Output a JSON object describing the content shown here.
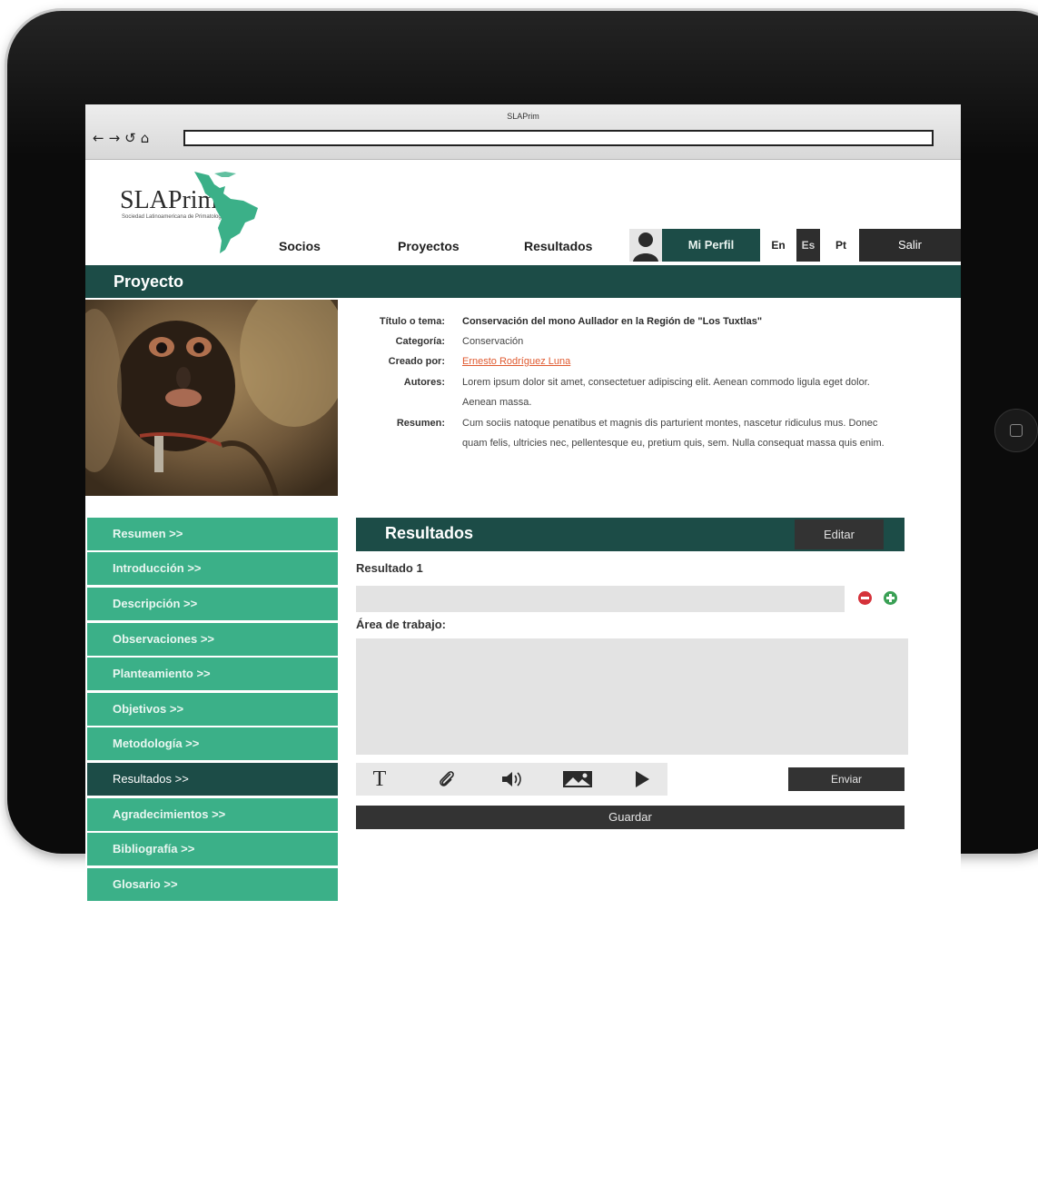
{
  "browser": {
    "window_title": "SLAPrim",
    "nav_icons": [
      "back-icon",
      "forward-icon",
      "reload-icon",
      "home-icon"
    ],
    "address_value": ""
  },
  "header": {
    "logo_title": "SLAPrim",
    "logo_subtitle": "Sociedad Latinoamericana de Primatología",
    "nav": [
      "Socios",
      "Proyectos",
      "Resultados"
    ],
    "profile_label": "Mi Perfil",
    "languages": [
      "En",
      "Es",
      "Pt"
    ],
    "selected_language": "Es",
    "logout_label": "Salir"
  },
  "section_title": "Proyecto",
  "project": {
    "labels": {
      "title": "Título o tema:",
      "category": "Categoría:",
      "created_by": "Creado por:",
      "authors": "Autores:",
      "summary": "Resumen:"
    },
    "title": "Conservación del mono Aullador en la Región de \"Los Tuxtlas\"",
    "category": "Conservación",
    "created_by": "Ernesto Rodríguez Luna",
    "authors": "Lorem ipsum dolor sit amet, consectetuer adipiscing elit. Aenean commodo ligula eget dolor. Aenean massa.",
    "summary": "Cum sociis natoque penatibus et magnis dis parturient montes, nascetur ridiculus mus. Donec quam felis, ultricies nec, pellentesque eu, pretium quis, sem. Nulla consequat massa quis enim."
  },
  "sidebar": {
    "items": [
      {
        "label": "Resumen >>"
      },
      {
        "label": "Introducción >>"
      },
      {
        "label": "Descripción >>"
      },
      {
        "label": "Observaciones >>"
      },
      {
        "label": "Planteamiento >>"
      },
      {
        "label": "Objetivos >>"
      },
      {
        "label": "Metodología >>"
      },
      {
        "label": "Resultados >>",
        "active": true
      },
      {
        "label": "Agradecimientos >>"
      },
      {
        "label": "Bibliografía >>"
      },
      {
        "label": "Glosario >>"
      }
    ]
  },
  "results": {
    "title": "Resultados",
    "edit_label": "Editar",
    "result_label": "Resultado 1",
    "result_value": "",
    "work_area_label": "Área de trabajo:",
    "work_area_value": "",
    "tools": [
      "text-icon",
      "attachment-icon",
      "audio-icon",
      "image-icon",
      "video-play-icon"
    ],
    "text_tool_glyph": "T",
    "send_label": "Enviar",
    "save_label": "Guardar"
  },
  "colors": {
    "dark_green": "#1c4c47",
    "accent_green": "#3bb088",
    "dark_button": "#333333",
    "input_gray": "#e3e3e3"
  }
}
